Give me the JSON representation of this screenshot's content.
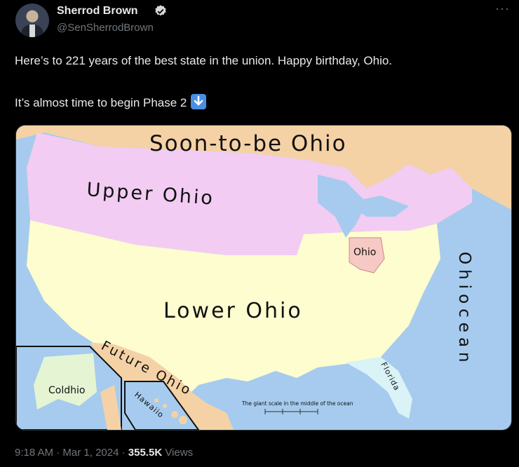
{
  "author": {
    "name": "Sherrod Brown",
    "handle": "@SenSherrodBrown"
  },
  "tweet": {
    "line1": "Here’s to 221 years of the best state in the union. Happy birthday, Ohio.",
    "line2": "It’s almost time to begin Phase 2"
  },
  "map": {
    "soon": "Soon-to-be Ohio",
    "upper": "Upper Ohio",
    "lower": "Lower Ohio",
    "ohio": "Ohio",
    "ohiocean": "Ohiocean",
    "future": "Future Ohio",
    "coldhio": "Coldhio",
    "hawaiio": "Hawaiio",
    "florida": "Florida",
    "scale": "The giant scale in the middle of the ocean"
  },
  "footer": {
    "time": "9:18 AM",
    "date": "Mar 1, 2024",
    "views_count": "355.5K",
    "views_label": "Views"
  },
  "colors": {
    "verified": "#1d9bf0",
    "ocean": "#a6cbee",
    "canada": "#f5d2a5",
    "upper": "#f2ccf2",
    "lower": "#fdfdcf",
    "ohio": "#f7c9c4",
    "alaska": "#e5f5d3",
    "florida": "#d9f3f7"
  }
}
